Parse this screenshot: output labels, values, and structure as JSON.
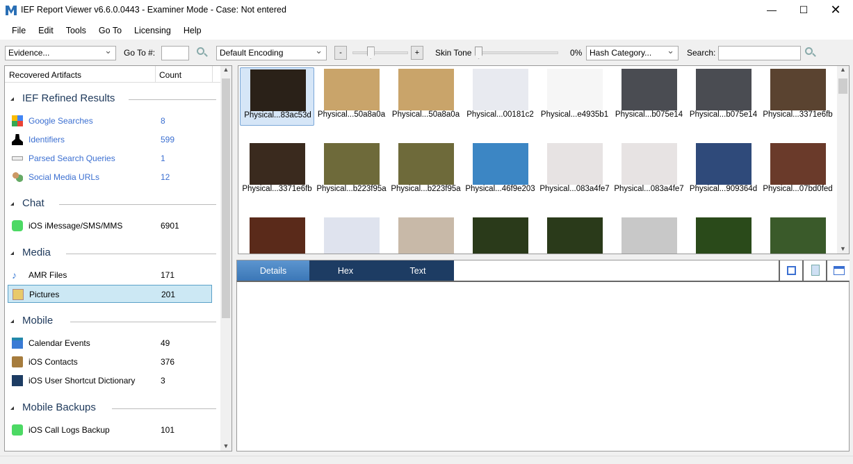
{
  "window": {
    "title": "IEF Report Viewer v6.6.0.0443 - Examiner Mode - Case: Not entered"
  },
  "menu": [
    "File",
    "Edit",
    "Tools",
    "Go To",
    "Licensing",
    "Help"
  ],
  "toolbar": {
    "evidence": "Evidence...",
    "goto_label": "Go To #:",
    "goto_value": "",
    "encoding": "Default Encoding",
    "minus": "-",
    "plus": "+",
    "zoom_level": 0.3,
    "skin_label": "Skin Tone",
    "skin_value": "0%",
    "hash": "Hash Category...",
    "search_label": "Search:",
    "search_value": ""
  },
  "left": {
    "col1": "Recovered Artifacts",
    "col2": "Count",
    "sections": [
      {
        "title": "IEF Refined Results",
        "items": [
          {
            "name": "Google Searches",
            "count": "8"
          },
          {
            "name": "Identifiers",
            "count": "599"
          },
          {
            "name": "Parsed Search Queries",
            "count": "1"
          },
          {
            "name": "Social Media URLs",
            "count": "12"
          }
        ]
      },
      {
        "title": "Chat",
        "items": [
          {
            "name": "iOS iMessage/SMS/MMS",
            "count": "6901"
          }
        ]
      },
      {
        "title": "Media",
        "items": [
          {
            "name": "AMR Files",
            "count": "171"
          },
          {
            "name": "Pictures",
            "count": "201"
          }
        ]
      },
      {
        "title": "Mobile",
        "items": [
          {
            "name": "Calendar Events",
            "count": "49"
          },
          {
            "name": "iOS Contacts",
            "count": "376"
          },
          {
            "name": "iOS User Shortcut Dictionary",
            "count": "3"
          }
        ]
      },
      {
        "title": "Mobile Backups",
        "items": [
          {
            "name": "iOS Call Logs Backup",
            "count": "101"
          }
        ]
      }
    ]
  },
  "gallery": {
    "captions": [
      "Physical...83ac53d",
      "Physical...50a8a0a",
      "Physical...50a8a0a",
      "Physical...00181c2",
      "Physical...e4935b1",
      "Physical...b075e14",
      "Physical...b075e14",
      "Physical...3371e6fb",
      "Physical...3371e6fb",
      "Physical...b223f95a",
      "Physical...b223f95a",
      "Physical...46f9e203",
      "Physical...083a4fe7",
      "Physical...083a4fe7",
      "Physical...909364d",
      "Physical...07bd0fed"
    ],
    "colors": [
      "#2a2118",
      "#c9a46a",
      "#c9a46a",
      "#e8eaf0",
      "#f6f6f6",
      "#4a4c52",
      "#4a4c52",
      "#5a4330",
      "#3a2a1e",
      "#6e6a3a",
      "#6e6a3a",
      "#3c86c4",
      "#e7e3e3",
      "#e7e3e3",
      "#2f4a7a",
      "#6a3a2a",
      "#5a2a1a",
      "#dfe3ee",
      "#c8b9a8",
      "#2a3a1a",
      "#2a3a1a",
      "#c8c8c8",
      "#2a4a1a",
      "#3a5a2a"
    ]
  },
  "tabs": [
    "Details",
    "Hex",
    "Text"
  ]
}
